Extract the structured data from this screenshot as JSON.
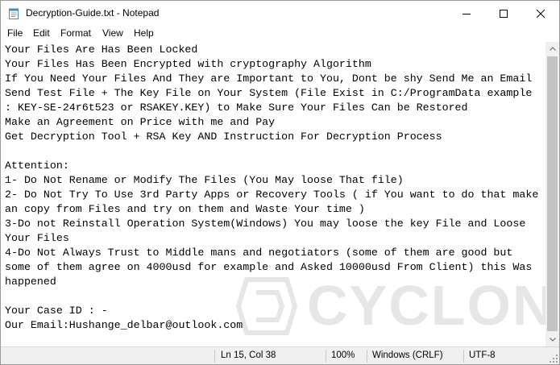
{
  "window": {
    "title": "Decryption-Guide.txt - Notepad",
    "icon": "notepad-icon"
  },
  "caption_buttons": [
    "minimize-icon",
    "maximize-icon",
    "close-icon"
  ],
  "menu": {
    "file": "File",
    "edit": "Edit",
    "format": "Format",
    "view": "View",
    "help": "Help"
  },
  "editor": {
    "lines": [
      "Your Files Are Has Been Locked",
      "Your Files Has Been Encrypted with cryptography Algorithm",
      "If You Need Your Files And They are Important to You, Dont be shy Send Me an Email",
      "Send Test File + The Key File on Your System (File Exist in C:/ProgramData example",
      ": KEY-SE-24r6t523 or RSAKEY.KEY) to Make Sure Your Files Can be Restored",
      "Make an Agreement on Price with me and Pay",
      "Get Decryption Tool + RSA Key AND Instruction For Decryption Process",
      "",
      "Attention:",
      "1- Do Not Rename or Modify The Files (You May loose That file)",
      "2- Do Not Try To Use 3rd Party Apps or Recovery Tools ( if You want to do that make",
      "an copy from Files and try on them and Waste Your time )",
      "3-Do not Reinstall Operation System(Windows) You may loose the key File and Loose",
      "Your Files",
      "4-Do Not Always Trust to Middle mans and negotiators (some of them are good but",
      "some of them agree on 4000usd for example and Asked 10000usd From Client) this Was",
      "happened",
      "",
      "Your Case ID : -",
      "Our Email:Hushange_delbar@outlook.com"
    ]
  },
  "watermark": {
    "text": "CYCLONIS"
  },
  "statusbar": {
    "position": "Ln 15, Col 38",
    "zoom": "100%",
    "line_ending": "Windows (CRLF)",
    "encoding": "UTF-8"
  }
}
